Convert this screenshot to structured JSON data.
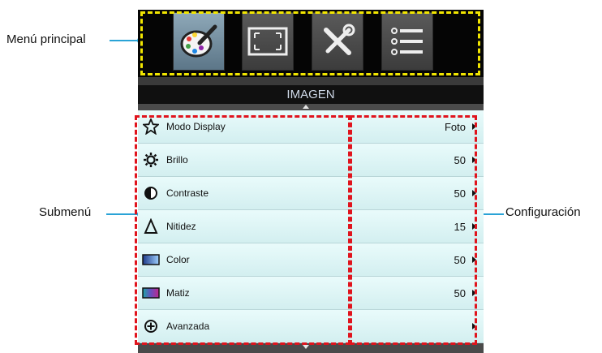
{
  "menu": {
    "title": "IMAGEN",
    "tabs": [
      {
        "icon": "palette-icon",
        "active": true
      },
      {
        "icon": "screen-resize-icon",
        "active": false
      },
      {
        "icon": "tools-icon",
        "active": false
      },
      {
        "icon": "list-settings-icon",
        "active": false
      }
    ],
    "items": [
      {
        "label": "Modo Display",
        "value": "Foto",
        "icon": "star-icon"
      },
      {
        "label": "Brillo",
        "value": "50",
        "icon": "sun-icon"
      },
      {
        "label": "Contraste",
        "value": "50",
        "icon": "contrast-icon"
      },
      {
        "label": "Nitidez",
        "value": "15",
        "icon": "delta-icon"
      },
      {
        "label": "Color",
        "value": "50",
        "icon": "color-swatch-icon"
      },
      {
        "label": "Matiz",
        "value": "50",
        "icon": "tint-swatch-icon"
      },
      {
        "label": "Avanzada",
        "value": "",
        "icon": "plus-circle-icon"
      }
    ]
  },
  "callouts": {
    "main_menu": "Menú principal",
    "submenu": "Submenú",
    "settings": "Configuración"
  },
  "colors": {
    "highlight_main_menu": "#f2e600",
    "highlight_submenu": "#e0141d",
    "callout_line": "#2aa3d6",
    "row_background": "#ddf3f4"
  }
}
